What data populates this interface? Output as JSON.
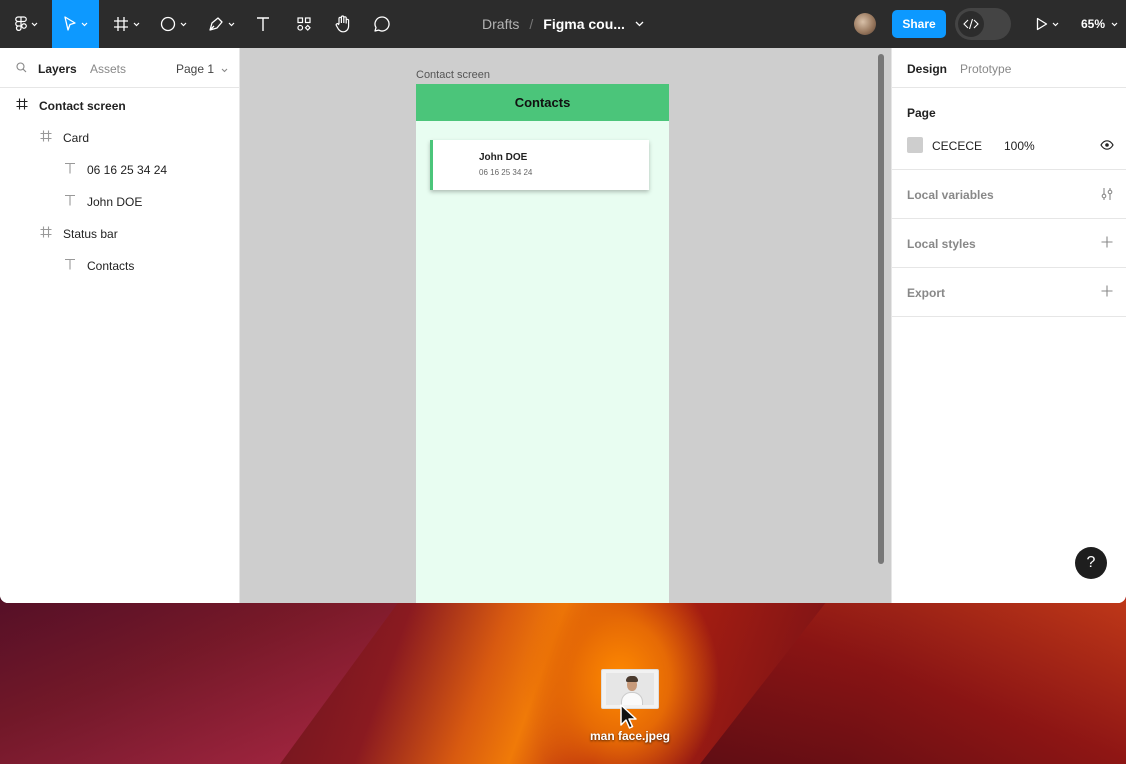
{
  "toolbar": {
    "breadcrumb": "Drafts",
    "separator": "/",
    "file_name": "Figma cou...",
    "share_label": "Share",
    "zoom": "65%"
  },
  "left_panel": {
    "tabs": {
      "layers": "Layers",
      "assets": "Assets"
    },
    "page_select": "Page 1",
    "layers": [
      {
        "name": "Contact screen",
        "type": "frame"
      },
      {
        "name": "Card",
        "type": "frame"
      },
      {
        "name": "06 16 25 34 24",
        "type": "text"
      },
      {
        "name": "John DOE",
        "type": "text"
      },
      {
        "name": "Status bar",
        "type": "frame"
      },
      {
        "name": "Contacts",
        "type": "text"
      }
    ]
  },
  "canvas": {
    "frame_label": "Contact screen",
    "header_title": "Contacts",
    "card": {
      "name": "John DOE",
      "phone": "06 16 25 34 24"
    },
    "background_color": "#CECECE",
    "header_color": "#4BC57A",
    "frame_color": "#E8FDF1"
  },
  "right_panel": {
    "tabs": {
      "design": "Design",
      "prototype": "Prototype"
    },
    "page_section": "Page",
    "page_color_hex": "CECECE",
    "page_color_opacity": "100%",
    "local_variables": "Local variables",
    "local_styles": "Local styles",
    "export": "Export"
  },
  "help_label": "?",
  "desktop": {
    "file_name": "man face.jpeg"
  },
  "colors": {
    "accent": "#0D99FF",
    "toolbar_bg": "#2C2C2C"
  }
}
